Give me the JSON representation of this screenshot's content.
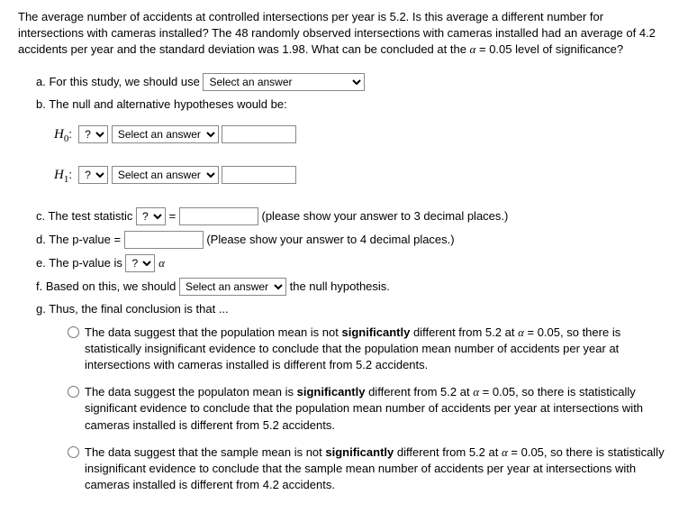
{
  "intro": "The average number of accidents at controlled intersections per year is 5.2.  Is this average a different number for intersections with cameras installed? The 48 randomly observed intersections with cameras installed had an average of 4.2 accidents per year and the standard deviation was 1.98. What can be concluded at the  ",
  "intro_alpha": "α",
  "intro_end": " = 0.05 level of significance?",
  "a": {
    "label": "a. For this study, we should use ",
    "select": "Select an answer"
  },
  "b": {
    "label": "b. The null and alternative hypotheses would be:",
    "h0_label": "H",
    "h0_sub": "0",
    "h1_label": "H",
    "h1_sub": "1",
    "colon": ":",
    "q_select": "?",
    "ans_select": "Select an answer"
  },
  "c": {
    "label": "c. The test statistic ",
    "q_select": "?",
    "equals": " = ",
    "hint": " (please show your answer to 3 decimal places.)"
  },
  "d": {
    "label": "d. The p-value = ",
    "hint": " (Please show your answer to 4 decimal places.)"
  },
  "e": {
    "label": "e. The p-value is ",
    "q_select": "?",
    "alpha": " α"
  },
  "f": {
    "label": "f. Based on this, we should ",
    "select": "Select an answer",
    "end": " the null hypothesis."
  },
  "g": {
    "label": "g. Thus, the final conclusion is that ..."
  },
  "options": [
    {
      "pre": "The data suggest that the population mean is not ",
      "bold": "significantly",
      "post1": " different from 5.2 at ",
      "alpha": "α",
      "post2": " = 0.05, so there is statistically insignificant evidence to conclude that the population mean number of accidents per year at intersections with cameras installed is different from 5.2 accidents."
    },
    {
      "pre": "The data suggest the populaton mean is ",
      "bold": "significantly",
      "post1": " different from 5.2 at ",
      "alpha": "α",
      "post2": " = 0.05, so there is statistically significant evidence to conclude that the population mean number of accidents per year at intersections with cameras installed is different from 5.2 accidents."
    },
    {
      "pre": "The data suggest that the sample mean is not ",
      "bold": "significantly",
      "post1": " different from 5.2 at ",
      "alpha": "α",
      "post2": " = 0.05, so there is statistically insignificant evidence to conclude that the sample mean number of accidents per year at intersections with cameras installed is different from 4.2 accidents."
    }
  ]
}
